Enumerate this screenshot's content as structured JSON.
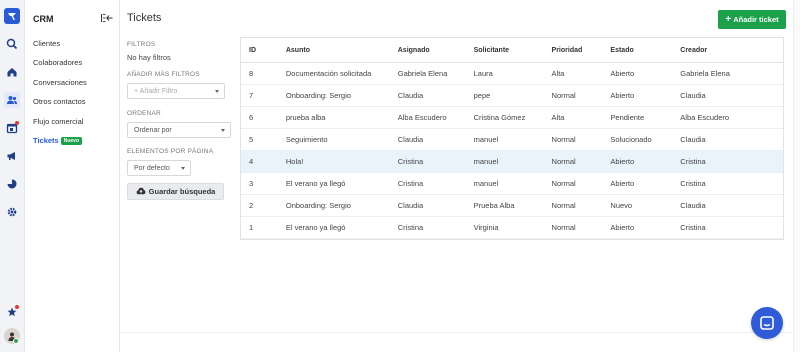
{
  "rail": {
    "icons": [
      "logo-icon",
      "search-icon",
      "home-icon",
      "users-icon",
      "calendar-icon",
      "megaphone-icon",
      "pie-chart-icon",
      "settings-icon",
      "star-icon",
      "avatar"
    ]
  },
  "sidebar": {
    "title": "CRM",
    "items": [
      {
        "label": "Clientes"
      },
      {
        "label": "Colaboradores"
      },
      {
        "label": "Conversaciones"
      },
      {
        "label": "Otros contactos"
      },
      {
        "label": "Flujo comercial"
      },
      {
        "label": "Tickets",
        "badge": "Nuevo"
      }
    ]
  },
  "header": {
    "title": "Tickets",
    "add_button": "Añadir ticket"
  },
  "filters": {
    "filters_heading": "FILTROS",
    "no_filters": "No hay filtros",
    "add_more_heading": "AÑADIR MÁS FILTROS",
    "add_filter_placeholder": "+ Añadir Filtro",
    "order_heading": "ORDENAR",
    "order_value": "Ordenar por",
    "per_page_heading": "ELEMENTOS POR PÁGINA",
    "per_page_value": "Por defecto",
    "save_button": "Guardar búsqueda"
  },
  "table": {
    "columns": [
      "ID",
      "Asunto",
      "Asignado",
      "Solicitante",
      "Prioridad",
      "Estado",
      "Creador"
    ],
    "rows": [
      [
        "8",
        "Documentación solicitada",
        "Gabriela Elena",
        "Laura",
        "Alta",
        "Abierto",
        "Gabriela Elena"
      ],
      [
        "7",
        "Onboarding: Sergio",
        "Claudia",
        "pepe",
        "Normal",
        "Abierto",
        "Claudia"
      ],
      [
        "6",
        "prueba alba",
        "Alba Escudero",
        "Cristina Gómez",
        "Alta",
        "Pendiente",
        "Alba Escudero"
      ],
      [
        "5",
        "Seguimiento",
        "Claudia",
        "manuel",
        "Normal",
        "Solucionado",
        "Claudia"
      ],
      [
        "4",
        "Hola!",
        "Cristina",
        "manuel",
        "Normal",
        "Abierto",
        "Cristina"
      ],
      [
        "3",
        "El verano ya llegó",
        "Cristina",
        "manuel",
        "Normal",
        "Abierto",
        "Cristina"
      ],
      [
        "2",
        "Onboarding: Sergio",
        "Claudia",
        "Prueba Alba",
        "Normal",
        "Nuevo",
        "Claudia"
      ],
      [
        "1",
        "El verano ya llegó",
        "Cristina",
        "Virginia",
        "Normal",
        "Abierto",
        "Cristina"
      ]
    ],
    "highlighted_row_id": "4"
  },
  "colors": {
    "accent": "#2a5bd7",
    "success": "#1aa14a",
    "highlight_row": "#e9f3fc"
  }
}
